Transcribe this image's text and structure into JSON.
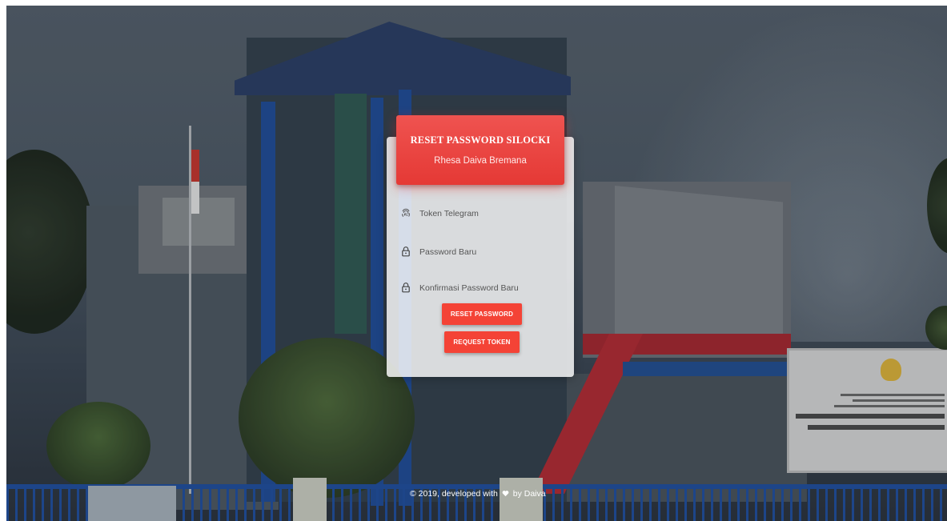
{
  "card": {
    "title": "RESET PASSWORD SILOCKI",
    "subtitle": "Rhesa Daiva Bremana"
  },
  "form": {
    "fields": [
      {
        "icon": "fingerprint-icon",
        "placeholder": "Token Telegram",
        "value": ""
      },
      {
        "icon": "lock-icon",
        "placeholder": "Password Baru",
        "value": ""
      },
      {
        "icon": "lock-icon",
        "placeholder": "Konfirmasi Password Baru",
        "value": ""
      }
    ],
    "buttons": {
      "reset": "RESET PASSWORD",
      "request": "REQUEST TOKEN"
    }
  },
  "footer": {
    "prefix": "© 2019, developed with",
    "suffix": "by Daiva"
  },
  "colors": {
    "accent": "#f44336",
    "header": "#e53935"
  }
}
